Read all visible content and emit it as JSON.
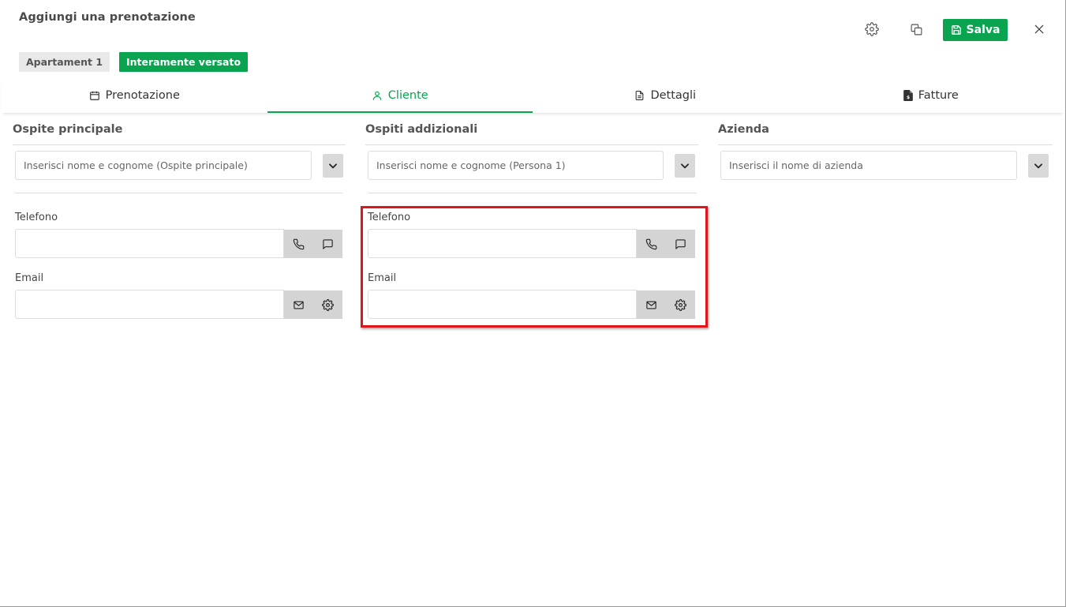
{
  "header": {
    "title": "Aggiungi una prenotazione",
    "save_label": "Salva",
    "icons": {
      "settings": "gear-icon",
      "duplicate": "copy-icon",
      "save": "floppy-disk-icon",
      "close": "close-icon"
    }
  },
  "badges": {
    "apartment": "Apartament 1",
    "payment_status": "Interamente versato"
  },
  "colors": {
    "accent": "#0aa34f",
    "highlight": "#e0141b",
    "addon_bg": "#d4d4d4"
  },
  "tabs": [
    {
      "label": "Prenotazione",
      "icon": "calendar-icon",
      "active": false
    },
    {
      "label": "Cliente",
      "icon": "user-icon",
      "active": true
    },
    {
      "label": "Dettagli",
      "icon": "document-icon",
      "active": false
    },
    {
      "label": "Fatture",
      "icon": "invoice-icon",
      "active": false
    }
  ],
  "main_guest": {
    "heading": "Ospite principale",
    "name_placeholder": "Inserisci nome e cognome (Ospite principale)",
    "phone_label": "Telefono",
    "phone_value": "",
    "email_label": "Email",
    "email_value": ""
  },
  "additional_guests": {
    "heading": "Ospiti addizionali",
    "name_placeholder": "Inserisci nome e cognome (Persona 1)",
    "phone_label": "Telefono",
    "phone_value": "",
    "email_label": "Email",
    "email_value": ""
  },
  "company": {
    "heading": "Azienda",
    "name_placeholder": "Inserisci il nome di azienda"
  }
}
